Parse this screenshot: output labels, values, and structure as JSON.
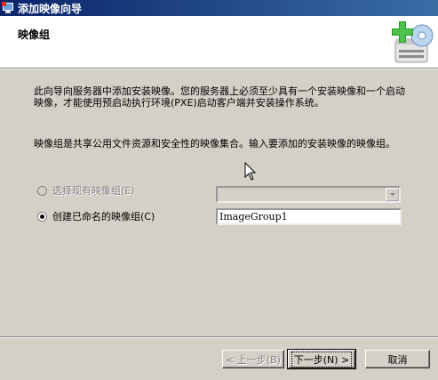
{
  "window": {
    "title": "添加映像向导"
  },
  "header": {
    "title": "映像组",
    "icon": "add-image-group-icon"
  },
  "description": {
    "line1": "此向导向服务器中添加安装映像。您的服务器上必须至少具有一个安装映像和一个启动映像，才能使用预启动执行环境(PXE)启动客户端并安装操作系统。",
    "line2": "映像组是共享公用文件资源和安全性的映像集合。输入要添加的安装映像的映像组。"
  },
  "options": {
    "existing": {
      "label": "选择现有映像组(E)",
      "enabled": false,
      "checked": false
    },
    "create": {
      "label": "创建已命名的映像组(C)",
      "enabled": true,
      "checked": true
    }
  },
  "group_name": {
    "value": "ImageGroup1"
  },
  "existing_select": {
    "value": ""
  },
  "buttons": {
    "back": "< 上一步(B)",
    "next": "下一步(N) >",
    "cancel": "取消"
  }
}
